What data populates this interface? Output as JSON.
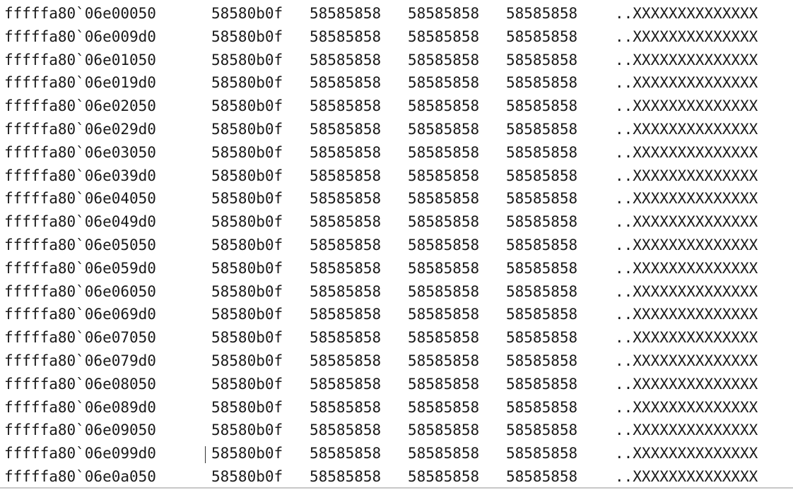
{
  "memory_dump": {
    "rows": [
      {
        "address": "fffffa80`06e00050",
        "words": [
          "58580b0f",
          "58585858",
          "58585858",
          "58585858"
        ],
        "ascii": "..XXXXXXXXXXXXXX"
      },
      {
        "address": "fffffa80`06e009d0",
        "words": [
          "58580b0f",
          "58585858",
          "58585858",
          "58585858"
        ],
        "ascii": "..XXXXXXXXXXXXXX"
      },
      {
        "address": "fffffa80`06e01050",
        "words": [
          "58580b0f",
          "58585858",
          "58585858",
          "58585858"
        ],
        "ascii": "..XXXXXXXXXXXXXX"
      },
      {
        "address": "fffffa80`06e019d0",
        "words": [
          "58580b0f",
          "58585858",
          "58585858",
          "58585858"
        ],
        "ascii": "..XXXXXXXXXXXXXX"
      },
      {
        "address": "fffffa80`06e02050",
        "words": [
          "58580b0f",
          "58585858",
          "58585858",
          "58585858"
        ],
        "ascii": "..XXXXXXXXXXXXXX"
      },
      {
        "address": "fffffa80`06e029d0",
        "words": [
          "58580b0f",
          "58585858",
          "58585858",
          "58585858"
        ],
        "ascii": "..XXXXXXXXXXXXXX"
      },
      {
        "address": "fffffa80`06e03050",
        "words": [
          "58580b0f",
          "58585858",
          "58585858",
          "58585858"
        ],
        "ascii": "..XXXXXXXXXXXXXX"
      },
      {
        "address": "fffffa80`06e039d0",
        "words": [
          "58580b0f",
          "58585858",
          "58585858",
          "58585858"
        ],
        "ascii": "..XXXXXXXXXXXXXX"
      },
      {
        "address": "fffffa80`06e04050",
        "words": [
          "58580b0f",
          "58585858",
          "58585858",
          "58585858"
        ],
        "ascii": "..XXXXXXXXXXXXXX"
      },
      {
        "address": "fffffa80`06e049d0",
        "words": [
          "58580b0f",
          "58585858",
          "58585858",
          "58585858"
        ],
        "ascii": "..XXXXXXXXXXXXXX"
      },
      {
        "address": "fffffa80`06e05050",
        "words": [
          "58580b0f",
          "58585858",
          "58585858",
          "58585858"
        ],
        "ascii": "..XXXXXXXXXXXXXX"
      },
      {
        "address": "fffffa80`06e059d0",
        "words": [
          "58580b0f",
          "58585858",
          "58585858",
          "58585858"
        ],
        "ascii": "..XXXXXXXXXXXXXX"
      },
      {
        "address": "fffffa80`06e06050",
        "words": [
          "58580b0f",
          "58585858",
          "58585858",
          "58585858"
        ],
        "ascii": "..XXXXXXXXXXXXXX"
      },
      {
        "address": "fffffa80`06e069d0",
        "words": [
          "58580b0f",
          "58585858",
          "58585858",
          "58585858"
        ],
        "ascii": "..XXXXXXXXXXXXXX"
      },
      {
        "address": "fffffa80`06e07050",
        "words": [
          "58580b0f",
          "58585858",
          "58585858",
          "58585858"
        ],
        "ascii": "..XXXXXXXXXXXXXX"
      },
      {
        "address": "fffffa80`06e079d0",
        "words": [
          "58580b0f",
          "58585858",
          "58585858",
          "58585858"
        ],
        "ascii": "..XXXXXXXXXXXXXX"
      },
      {
        "address": "fffffa80`06e08050",
        "words": [
          "58580b0f",
          "58585858",
          "58585858",
          "58585858"
        ],
        "ascii": "..XXXXXXXXXXXXXX"
      },
      {
        "address": "fffffa80`06e089d0",
        "words": [
          "58580b0f",
          "58585858",
          "58585858",
          "58585858"
        ],
        "ascii": "..XXXXXXXXXXXXXX"
      },
      {
        "address": "fffffa80`06e09050",
        "words": [
          "58580b0f",
          "58585858",
          "58585858",
          "58585858"
        ],
        "ascii": "..XXXXXXXXXXXXXX"
      },
      {
        "address": "fffffa80`06e099d0",
        "words": [
          "58580b0f",
          "58585858",
          "58585858",
          "58585858"
        ],
        "ascii": "..XXXXXXXXXXXXXX"
      },
      {
        "address": "fffffa80`06e0a050",
        "words": [
          "58580b0f",
          "58585858",
          "58585858",
          "58585858"
        ],
        "ascii": "..XXXXXXXXXXXXXX"
      }
    ]
  },
  "colors": {
    "text": "#1a1a1a",
    "background": "#ffffff"
  }
}
